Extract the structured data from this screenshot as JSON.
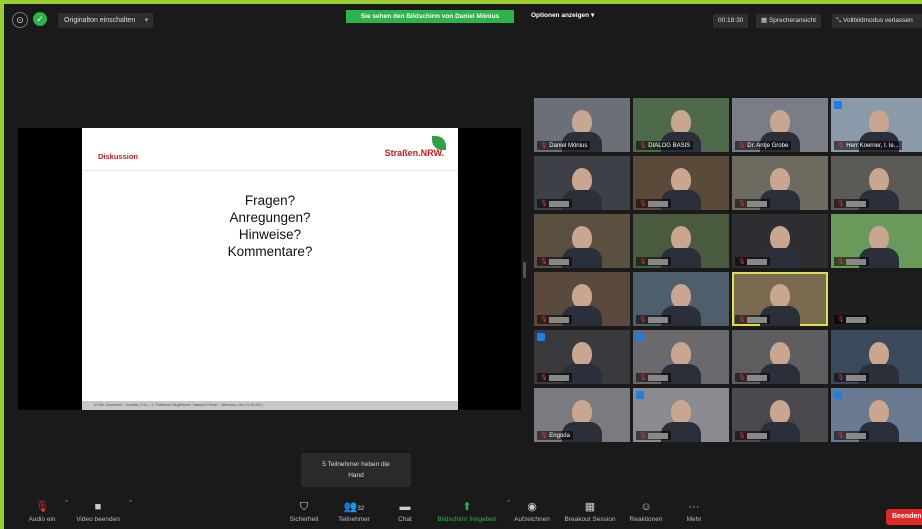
{
  "topbar": {
    "original_sound_label": "Originalton einschalten",
    "share_banner": "Sie sehen den Bildschirm von Daniel Mönius",
    "options_label": "Optionen anzeigen",
    "timer": "00:18:30",
    "speaker_view_label": "Sprecheransicht",
    "fullscreen_label": "Vollbildmodus verlassen"
  },
  "slide": {
    "title": "Diskussion",
    "logo_text": "Straßen.NRW.",
    "lines": [
      "Fragen?",
      "Anregungen?",
      "Hinweise?",
      "Kommentare?"
    ],
    "footer": "IZ NW, Sauerland – Homolls | 9.11 – 1. Politischer Begleitkreis \"Instadort Herne\" - Wiechanz, den 01.06.2021"
  },
  "participants": [
    {
      "name": "Daniel Mönius"
    },
    {
      "name": "DIALOG BASIS"
    },
    {
      "name": "Dr. Antje Grobe"
    },
    {
      "name": "Herr Koerner, I. le..."
    },
    {
      "name": "Engoda"
    }
  ],
  "tooltip": {
    "line1": "5 Teilnehmer heben die",
    "line2": "Hand"
  },
  "toolbar": {
    "audio": "Audio ein",
    "video": "Video beenden",
    "security": "Sicherheit",
    "participants": "Teilnehmer",
    "participants_count": "32",
    "chat": "Chat",
    "share": "Bildschirm freigeben",
    "record": "Aufzeichnen",
    "breakout": "Breakout Session",
    "reactions": "Reaktionen",
    "more": "Mehr",
    "end": "Beenden"
  },
  "colors": {
    "border": "#9acd32",
    "share_green": "#2bb44a",
    "end_red": "#e02828",
    "active_speaker": "#d7e24a",
    "slide_accent": "#c81e1e"
  }
}
